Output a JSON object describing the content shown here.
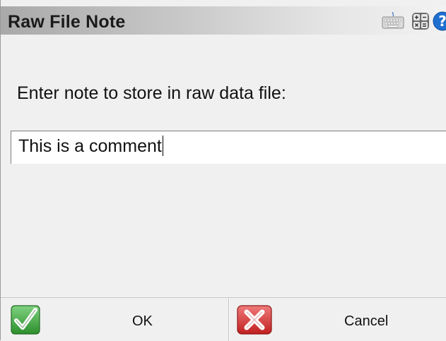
{
  "window": {
    "title": "Raw File Note",
    "icons": [
      "keyboard-icon",
      "calculator-icon",
      "help-icon"
    ]
  },
  "form": {
    "prompt": "Enter note to store in raw data file:",
    "note_value": "This is a comment"
  },
  "buttons": {
    "ok_label": "OK",
    "cancel_label": "Cancel"
  },
  "colors": {
    "ok_green": "#3aa53a",
    "cancel_red": "#d42a2a",
    "help_blue": "#1e6fd0",
    "background": "#f0f0f0"
  }
}
